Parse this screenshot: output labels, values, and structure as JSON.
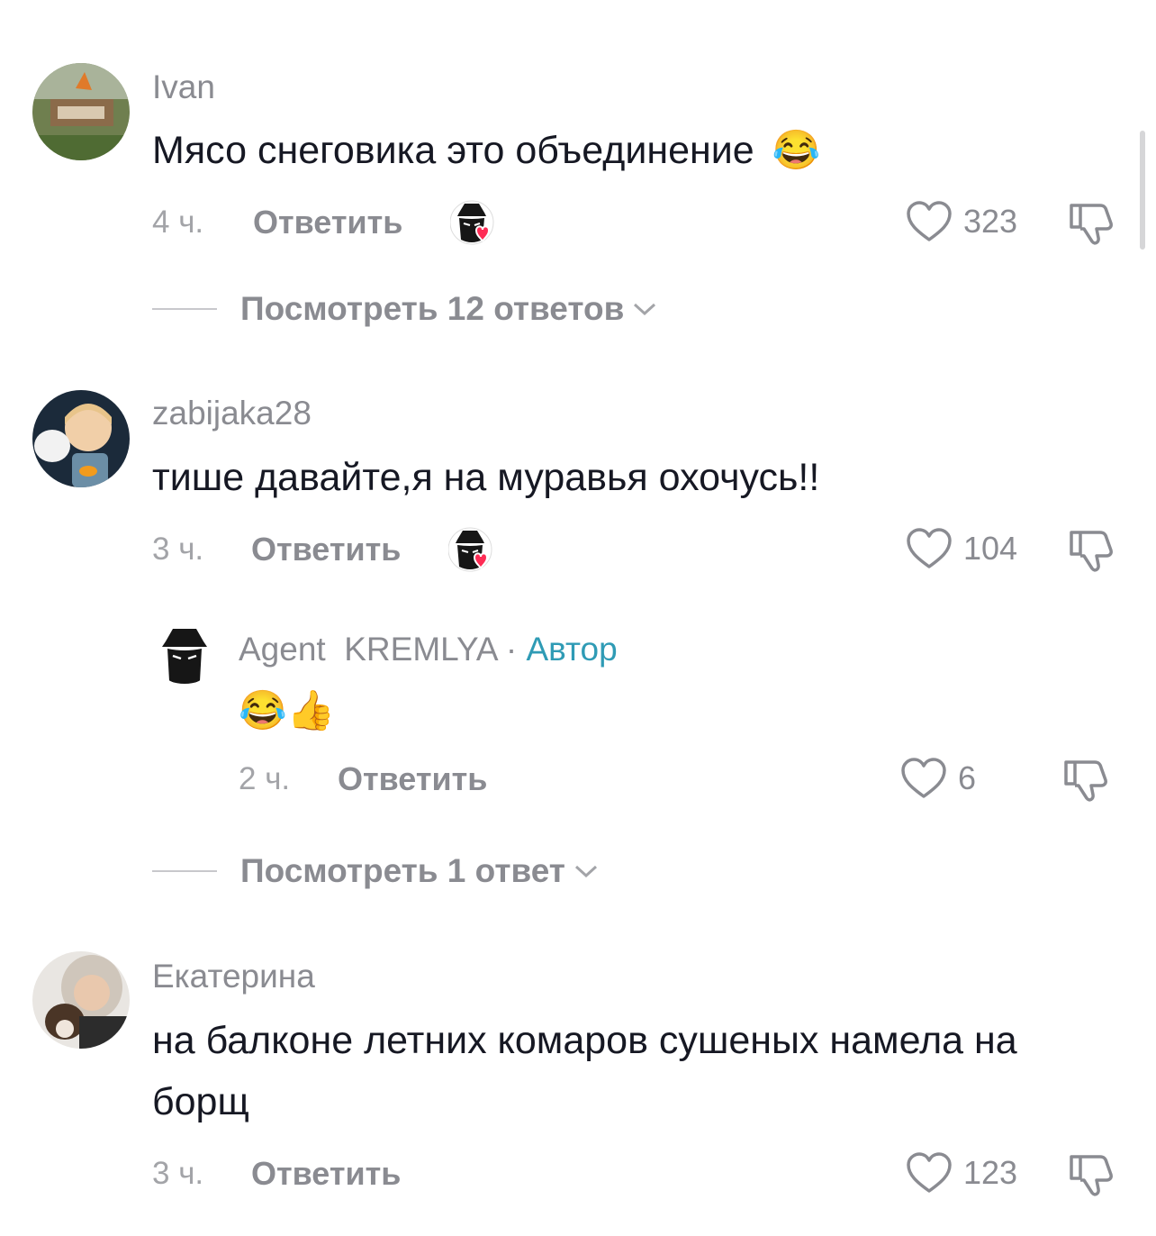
{
  "comments": [
    {
      "username": "Ivan",
      "text": "Мясо снеговика это объединение",
      "emoji": "😂",
      "time": "4 ч.",
      "reply_label": "Ответить",
      "likes": "323",
      "liked_by_creator": true,
      "view_replies": "Посмотреть 12 ответов"
    },
    {
      "username": "zabijaka28",
      "text": "тише давайте,я на муравья охочусь!!",
      "time": "3 ч.",
      "reply_label": "Ответить",
      "likes": "104",
      "liked_by_creator": true,
      "reply": {
        "username": "Agent  KREMLYA",
        "separator": " · ",
        "author_label": "Автор",
        "text": "😂👍",
        "time": "2 ч.",
        "reply_label": "Ответить",
        "likes": "6"
      },
      "view_replies": "Посмотреть 1 ответ"
    },
    {
      "username": "Екатерина",
      "text_line1": "на балконе летних комаров сушеных намела на",
      "text_line2": "борщ",
      "time": "3 ч.",
      "reply_label": "Ответить",
      "likes": "123"
    }
  ],
  "colors": {
    "text": "#161823",
    "secondary": "#8a8b91",
    "author": "#2f9bb5",
    "heart": "#fe2c55"
  },
  "icons": [
    "heart-outline-icon",
    "thumbs-down-icon",
    "chevron-down-icon",
    "creator-liked-icon"
  ]
}
